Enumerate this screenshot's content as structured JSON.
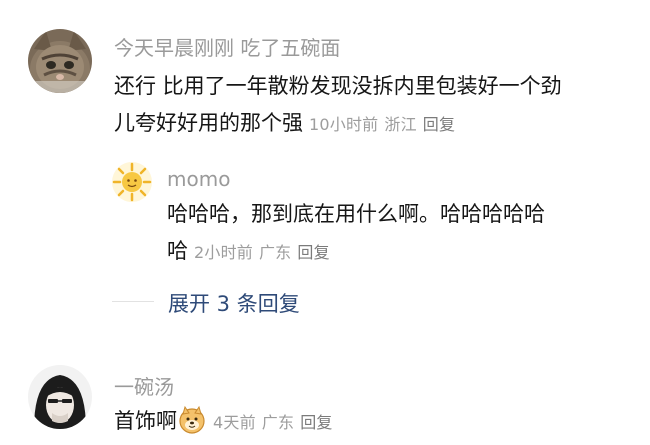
{
  "comments": [
    {
      "username": "今天早晨刚刚 吃了五碗面",
      "line1": "还行 比用了一年散粉发现没拆内里包装好一个劲",
      "line2": "儿夸好好用的那个强",
      "time": "10小时前",
      "location": "浙江",
      "reply_label": "回复",
      "avatar_icon": "cat-avatar"
    },
    {
      "username": "momo",
      "line1": "哈哈哈，那到底在用什么啊。哈哈哈哈哈",
      "line2": "哈",
      "time": "2小时前",
      "location": "广东",
      "reply_label": "回复",
      "avatar_icon": "sun-avatar"
    },
    {
      "username": "一碗汤",
      "line1": "首饰啊",
      "time": "4天前",
      "location": "广东",
      "reply_label": "回复",
      "avatar_icon": "hooded-figure-avatar",
      "emoji": "doge-emoji"
    }
  ],
  "expand_label": "展开 3 条回复",
  "colors": {
    "link": "#2e4a78",
    "meta": "#9d9d9d",
    "username": "#9a9a9a"
  }
}
